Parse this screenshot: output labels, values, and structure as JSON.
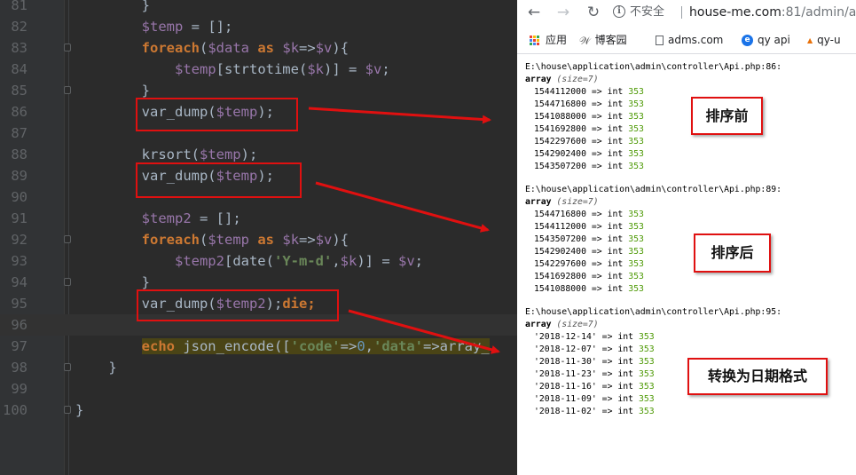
{
  "editor": {
    "lines": [
      {
        "n": "81",
        "segs": [
          {
            "t": "        }",
            "c": "c-def"
          }
        ]
      },
      {
        "n": "82",
        "segs": [
          {
            "t": "        ",
            "c": "c-def"
          },
          {
            "t": "$temp",
            "c": "var"
          },
          {
            "t": " = [];",
            "c": "c-def"
          }
        ]
      },
      {
        "n": "83",
        "segs": [
          {
            "t": "        ",
            "c": "c-def"
          },
          {
            "t": "foreach",
            "c": "kw"
          },
          {
            "t": "(",
            "c": "c-def"
          },
          {
            "t": "$data",
            "c": "var"
          },
          {
            "t": " ",
            "c": "c-def"
          },
          {
            "t": "as",
            "c": "kw"
          },
          {
            "t": " ",
            "c": "c-def"
          },
          {
            "t": "$k",
            "c": "var"
          },
          {
            "t": "=>",
            "c": "c-def"
          },
          {
            "t": "$v",
            "c": "var"
          },
          {
            "t": "){",
            "c": "c-def"
          }
        ]
      },
      {
        "n": "84",
        "segs": [
          {
            "t": "            ",
            "c": "c-def"
          },
          {
            "t": "$temp",
            "c": "var"
          },
          {
            "t": "[strtotime(",
            "c": "c-def"
          },
          {
            "t": "$k",
            "c": "var"
          },
          {
            "t": ")] = ",
            "c": "c-def"
          },
          {
            "t": "$v",
            "c": "var"
          },
          {
            "t": ";",
            "c": "c-def"
          }
        ]
      },
      {
        "n": "85",
        "segs": [
          {
            "t": "        }",
            "c": "c-def"
          }
        ]
      },
      {
        "n": "86",
        "segs": [
          {
            "t": "        var_dump(",
            "c": "c-def"
          },
          {
            "t": "$temp",
            "c": "var"
          },
          {
            "t": ");",
            "c": "c-def"
          }
        ]
      },
      {
        "n": "87",
        "segs": []
      },
      {
        "n": "88",
        "segs": [
          {
            "t": "        krsort(",
            "c": "c-def"
          },
          {
            "t": "$temp",
            "c": "var"
          },
          {
            "t": ");",
            "c": "c-def"
          }
        ]
      },
      {
        "n": "89",
        "segs": [
          {
            "t": "        var_dump(",
            "c": "c-def"
          },
          {
            "t": "$temp",
            "c": "var"
          },
          {
            "t": ");",
            "c": "c-def"
          }
        ]
      },
      {
        "n": "90",
        "segs": []
      },
      {
        "n": "91",
        "segs": [
          {
            "t": "        ",
            "c": "c-def"
          },
          {
            "t": "$temp2",
            "c": "var"
          },
          {
            "t": " = [];",
            "c": "c-def"
          }
        ]
      },
      {
        "n": "92",
        "segs": [
          {
            "t": "        ",
            "c": "c-def"
          },
          {
            "t": "foreach",
            "c": "kw"
          },
          {
            "t": "(",
            "c": "c-def"
          },
          {
            "t": "$temp",
            "c": "var"
          },
          {
            "t": " ",
            "c": "c-def"
          },
          {
            "t": "as",
            "c": "kw"
          },
          {
            "t": " ",
            "c": "c-def"
          },
          {
            "t": "$k",
            "c": "var"
          },
          {
            "t": "=>",
            "c": "c-def"
          },
          {
            "t": "$v",
            "c": "var"
          },
          {
            "t": "){",
            "c": "c-def"
          }
        ]
      },
      {
        "n": "93",
        "segs": [
          {
            "t": "            ",
            "c": "c-def"
          },
          {
            "t": "$temp2",
            "c": "var"
          },
          {
            "t": "[date(",
            "c": "c-def"
          },
          {
            "t": "'Y-m-d'",
            "c": "str"
          },
          {
            "t": ",",
            "c": "c-def"
          },
          {
            "t": "$k",
            "c": "var"
          },
          {
            "t": ")] = ",
            "c": "c-def"
          },
          {
            "t": "$v",
            "c": "var"
          },
          {
            "t": ";",
            "c": "c-def"
          }
        ]
      },
      {
        "n": "94",
        "segs": [
          {
            "t": "        }",
            "c": "c-def"
          }
        ]
      },
      {
        "n": "95",
        "segs": [
          {
            "t": "        var_dump(",
            "c": "c-def"
          },
          {
            "t": "$temp2",
            "c": "var"
          },
          {
            "t": ");",
            "c": "c-def"
          },
          {
            "t": "die",
            "c": "kw"
          },
          {
            "t": ";",
            "c": "kw"
          }
        ]
      },
      {
        "n": "96",
        "segs": [],
        "caret": true
      },
      {
        "n": "97",
        "segs": [
          {
            "t": "        ",
            "c": "c-def"
          },
          {
            "t": "echo",
            "c": "kw hl"
          },
          {
            "t": " json_encode([",
            "c": "c-def hl"
          },
          {
            "t": "'code'",
            "c": "str hl"
          },
          {
            "t": "=>",
            "c": "c-def hl"
          },
          {
            "t": "0",
            "c": "num hl"
          },
          {
            "t": ",",
            "c": "c-def hl"
          },
          {
            "t": "'data'",
            "c": "str hl"
          },
          {
            "t": "=>array_",
            "c": "c-def hl"
          }
        ]
      },
      {
        "n": "98",
        "segs": [
          {
            "t": "    }",
            "c": "c-def"
          }
        ]
      },
      {
        "n": "99",
        "segs": []
      },
      {
        "n": "100",
        "segs": [
          {
            "t": "}",
            "c": "c-def"
          }
        ]
      }
    ]
  },
  "browser": {
    "insecure_label": "不安全",
    "url_host": "house-me.com",
    "url_path": ":81/admin/a",
    "bookmarks": [
      {
        "label": "应用",
        "icon": "apps-grid-icon"
      },
      {
        "label": "博客园",
        "icon": "bookmark-blog-icon"
      },
      {
        "label": "adms.com",
        "icon": "page-icon"
      },
      {
        "label": "qy api",
        "icon": "bookmark-e-icon"
      },
      {
        "label": "qy-u",
        "icon": "pma-icon"
      }
    ],
    "dumps": [
      {
        "path": "E:\\house\\application\\admin\\controller\\Api.php:86:",
        "array_kw": "array",
        "size": "(size=7)",
        "rows": [
          {
            "k": "1544112000",
            "t": "int",
            "v": "353"
          },
          {
            "k": "1544716800",
            "t": "int",
            "v": "353"
          },
          {
            "k": "1541088000",
            "t": "int",
            "v": "353"
          },
          {
            "k": "1541692800",
            "t": "int",
            "v": "353"
          },
          {
            "k": "1542297600",
            "t": "int",
            "v": "353"
          },
          {
            "k": "1542902400",
            "t": "int",
            "v": "353"
          },
          {
            "k": "1543507200",
            "t": "int",
            "v": "353"
          }
        ]
      },
      {
        "path": "E:\\house\\application\\admin\\controller\\Api.php:89:",
        "array_kw": "array",
        "size": "(size=7)",
        "rows": [
          {
            "k": "1544716800",
            "t": "int",
            "v": "353"
          },
          {
            "k": "1544112000",
            "t": "int",
            "v": "353"
          },
          {
            "k": "1543507200",
            "t": "int",
            "v": "353"
          },
          {
            "k": "1542902400",
            "t": "int",
            "v": "353"
          },
          {
            "k": "1542297600",
            "t": "int",
            "v": "353"
          },
          {
            "k": "1541692800",
            "t": "int",
            "v": "353"
          },
          {
            "k": "1541088000",
            "t": "int",
            "v": "353"
          }
        ]
      },
      {
        "path": "E:\\house\\application\\admin\\controller\\Api.php:95:",
        "array_kw": "array",
        "size": "(size=7)",
        "rows": [
          {
            "k": "'2018-12-14'",
            "t": "int",
            "v": "353"
          },
          {
            "k": "'2018-12-07'",
            "t": "int",
            "v": "353"
          },
          {
            "k": "'2018-11-30'",
            "t": "int",
            "v": "353"
          },
          {
            "k": "'2018-11-23'",
            "t": "int",
            "v": "353"
          },
          {
            "k": "'2018-11-16'",
            "t": "int",
            "v": "353"
          },
          {
            "k": "'2018-11-09'",
            "t": "int",
            "v": "353"
          },
          {
            "k": "'2018-11-02'",
            "t": "int",
            "v": "353"
          }
        ]
      }
    ]
  },
  "annotations": {
    "before_sort": "排序前",
    "after_sort": "排序后",
    "to_date_format": "转换为日期格式"
  },
  "colors": {
    "annotation_red": "#e01010",
    "php_keyword": "#cc7832",
    "php_variable": "#9876aa",
    "php_string": "#6a8759",
    "dump_value": "#4e9a06"
  }
}
